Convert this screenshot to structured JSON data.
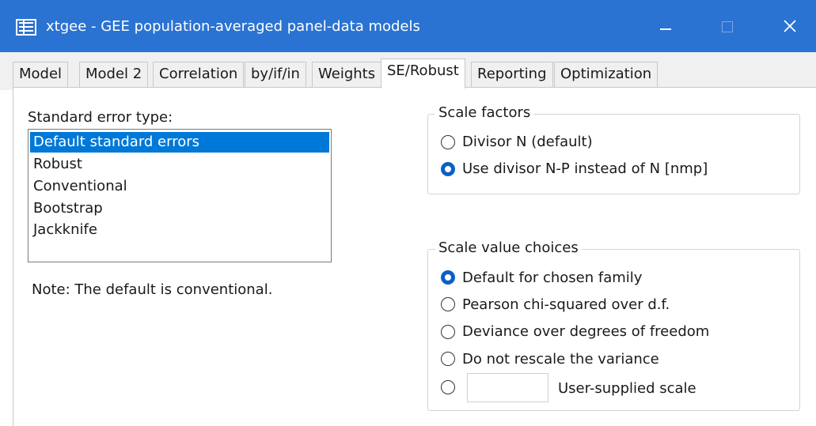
{
  "window": {
    "title": "xtgee - GEE population-averaged panel-data models",
    "icon": "table-icon",
    "titlebar_color": "#2a73d2"
  },
  "tabs": [
    {
      "label": "Model",
      "active": false
    },
    {
      "label": "Model 2",
      "active": false
    },
    {
      "label": "Correlation",
      "active": false
    },
    {
      "label": "by/if/in",
      "active": false
    },
    {
      "label": "Weights",
      "active": false
    },
    {
      "label": "SE/Robust",
      "active": true
    },
    {
      "label": "Reporting",
      "active": false
    },
    {
      "label": "Optimization",
      "active": false
    }
  ],
  "se_type": {
    "label": "Standard error type:",
    "items": [
      {
        "label": "Default standard errors",
        "selected": true
      },
      {
        "label": "Robust",
        "selected": false
      },
      {
        "label": "Conventional",
        "selected": false
      },
      {
        "label": "Bootstrap",
        "selected": false
      },
      {
        "label": "Jackknife",
        "selected": false
      }
    ],
    "note": "Note: The default is conventional.",
    "selection_color": "#0078d7"
  },
  "scale_factors": {
    "title": "Scale factors",
    "options": [
      {
        "label": "Divisor N (default)",
        "checked": false
      },
      {
        "label": "Use divisor N-P instead of N [nmp]",
        "checked": true
      }
    ]
  },
  "scale_value": {
    "title": "Scale value choices",
    "options": [
      {
        "label": "Default for chosen family",
        "checked": true
      },
      {
        "label": "Pearson chi-squared over d.f.",
        "checked": false
      },
      {
        "label": "Deviance over degrees of freedom",
        "checked": false
      },
      {
        "label": "Do not rescale the variance",
        "checked": false
      },
      {
        "label": "",
        "checked": false
      }
    ],
    "user_scale_label": "User-supplied scale",
    "user_scale_value": ""
  }
}
